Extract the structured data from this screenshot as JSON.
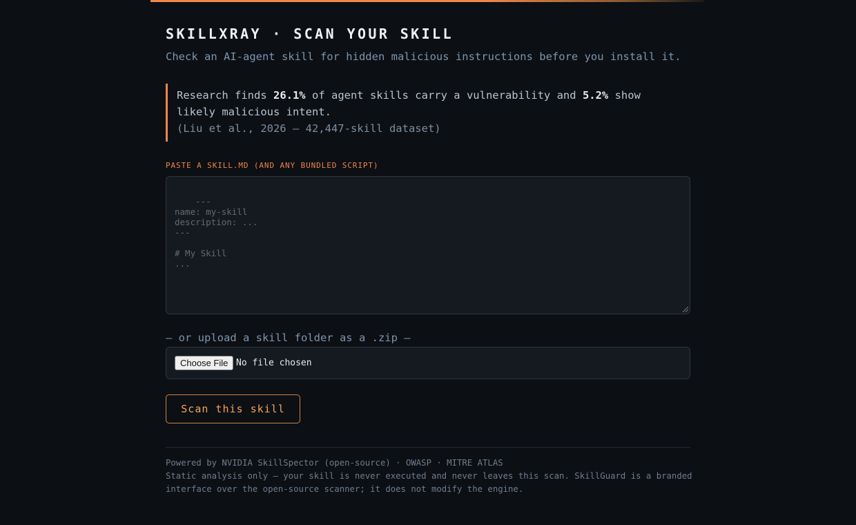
{
  "header": {
    "title": "SKILLXRAY · SCAN YOUR SKILL",
    "subtitle": "Check an AI-agent skill for hidden malicious instructions before you install it."
  },
  "callout": {
    "text_1": "Research finds ",
    "stat_vulnerable": "26.1%",
    "text_2": " of agent skills carry a vulnerability and ",
    "stat_malicious": "5.2%",
    "text_3": " show likely malicious intent.",
    "citation": "(Liu et al., 2026 — 42,447-skill dataset)"
  },
  "skill_input": {
    "label": "PASTE A SKILL.MD (AND ANY BUNDLED SCRIPT)",
    "placeholder": "---\nname: my-skill\ndescription: ...\n---\n\n# My Skill\n..."
  },
  "upload": {
    "label": "— or upload a skill folder as a .zip —",
    "button_label": "Choose File",
    "status": "No file chosen"
  },
  "actions": {
    "scan_label": "Scan this skill"
  },
  "footer": {
    "line_1": "Powered by NVIDIA SkillSpector (open-source) · OWASP · MITRE ATLAS",
    "line_2": "Static analysis only — your skill is never executed and never leaves this scan. SkillGuard is a branded",
    "line_3": "interface over the open-source scanner; it does not modify the engine."
  },
  "colors": {
    "background": "#0c0f14",
    "accent": "#ee8549",
    "button_border": "#c9873f",
    "button_text": "#f0a558"
  }
}
